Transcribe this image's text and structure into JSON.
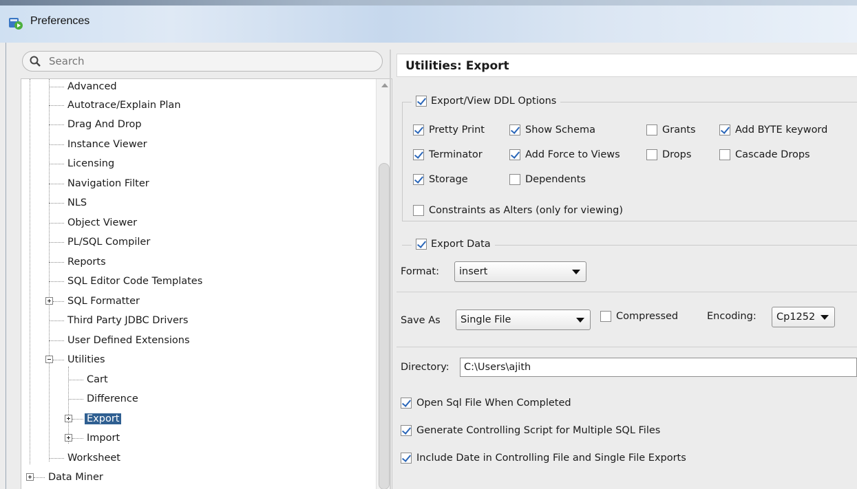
{
  "window": {
    "title": "Preferences"
  },
  "search": {
    "placeholder": "Search"
  },
  "tree": {
    "items": [
      {
        "label": "Advanced"
      },
      {
        "label": "Autotrace/Explain Plan"
      },
      {
        "label": "Drag And Drop"
      },
      {
        "label": "Instance Viewer"
      },
      {
        "label": "Licensing"
      },
      {
        "label": "Navigation Filter"
      },
      {
        "label": "NLS"
      },
      {
        "label": "Object Viewer"
      },
      {
        "label": "PL/SQL Compiler"
      },
      {
        "label": "Reports"
      },
      {
        "label": "SQL Editor Code Templates"
      },
      {
        "label": "SQL Formatter"
      },
      {
        "label": "Third Party JDBC Drivers"
      },
      {
        "label": "User Defined Extensions"
      },
      {
        "label": "Utilities"
      },
      {
        "label": "Cart"
      },
      {
        "label": "Difference"
      },
      {
        "label": "Export"
      },
      {
        "label": "Import"
      },
      {
        "label": "Worksheet"
      },
      {
        "label": "Data Miner"
      }
    ]
  },
  "page": {
    "title": "Utilities: Export"
  },
  "ddl": {
    "group_label": "Export/View DDL Options",
    "group_checked": true,
    "options": {
      "pretty_print": {
        "label": "Pretty Print",
        "checked": true
      },
      "show_schema": {
        "label": "Show Schema",
        "checked": true
      },
      "grants": {
        "label": "Grants",
        "checked": false
      },
      "add_byte": {
        "label": "Add BYTE keyword",
        "checked": true
      },
      "terminator": {
        "label": "Terminator",
        "checked": true
      },
      "add_force": {
        "label": "Add Force to Views",
        "checked": true
      },
      "drops": {
        "label": "Drops",
        "checked": false
      },
      "cascade_drops": {
        "label": "Cascade Drops",
        "checked": false
      },
      "storage": {
        "label": "Storage",
        "checked": true
      },
      "dependents": {
        "label": "Dependents",
        "checked": false
      },
      "constraints_alters": {
        "label": "Constraints as Alters (only for viewing)",
        "checked": false
      }
    }
  },
  "export_data": {
    "group_label": "Export Data",
    "group_checked": true,
    "format_label": "Format:",
    "format_value": "insert"
  },
  "save": {
    "label": "Save As",
    "value": "Single File",
    "compressed_label": "Compressed",
    "compressed_checked": false,
    "encoding_label": "Encoding:",
    "encoding_value": "Cp1252"
  },
  "directory": {
    "label": "Directory:",
    "value": "C:\\Users\\ajith"
  },
  "options": {
    "open_sql": {
      "label": "Open Sql File When Completed",
      "checked": true
    },
    "generate_script": {
      "label": "Generate Controlling Script for Multiple SQL Files",
      "checked": true
    },
    "include_date": {
      "label": "Include Date in Controlling File and Single File Exports",
      "checked": true
    }
  },
  "colors": {
    "selection": "#2f5f91",
    "check": "#2a66b8"
  }
}
